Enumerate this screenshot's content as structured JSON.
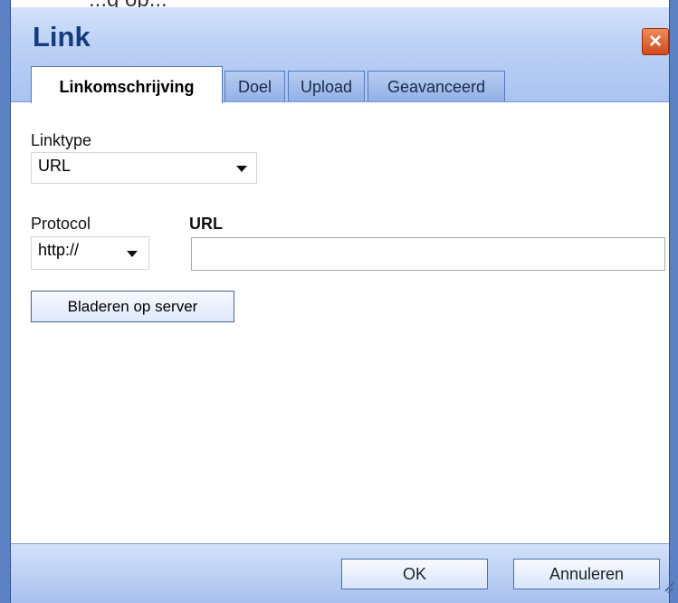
{
  "dialog": {
    "title": "Link",
    "close_icon": "close-icon",
    "background_text": "...g op...",
    "tabs": [
      {
        "label": "Linkomschrijving",
        "active": true
      },
      {
        "label": "Doel",
        "active": false
      },
      {
        "label": "Upload",
        "active": false
      },
      {
        "label": "Geavanceerd",
        "active": false
      }
    ],
    "linktype": {
      "label": "Linktype",
      "selected": "URL"
    },
    "protocol": {
      "label": "Protocol",
      "selected": "http://"
    },
    "url": {
      "label": "URL",
      "value": ""
    },
    "browse_button": "Bladeren op server",
    "buttons": {
      "ok": "OK",
      "cancel": "Annuleren"
    },
    "colors": {
      "frame": "#5d82c4",
      "title": "#153b82",
      "close": "#d24a1d"
    }
  }
}
